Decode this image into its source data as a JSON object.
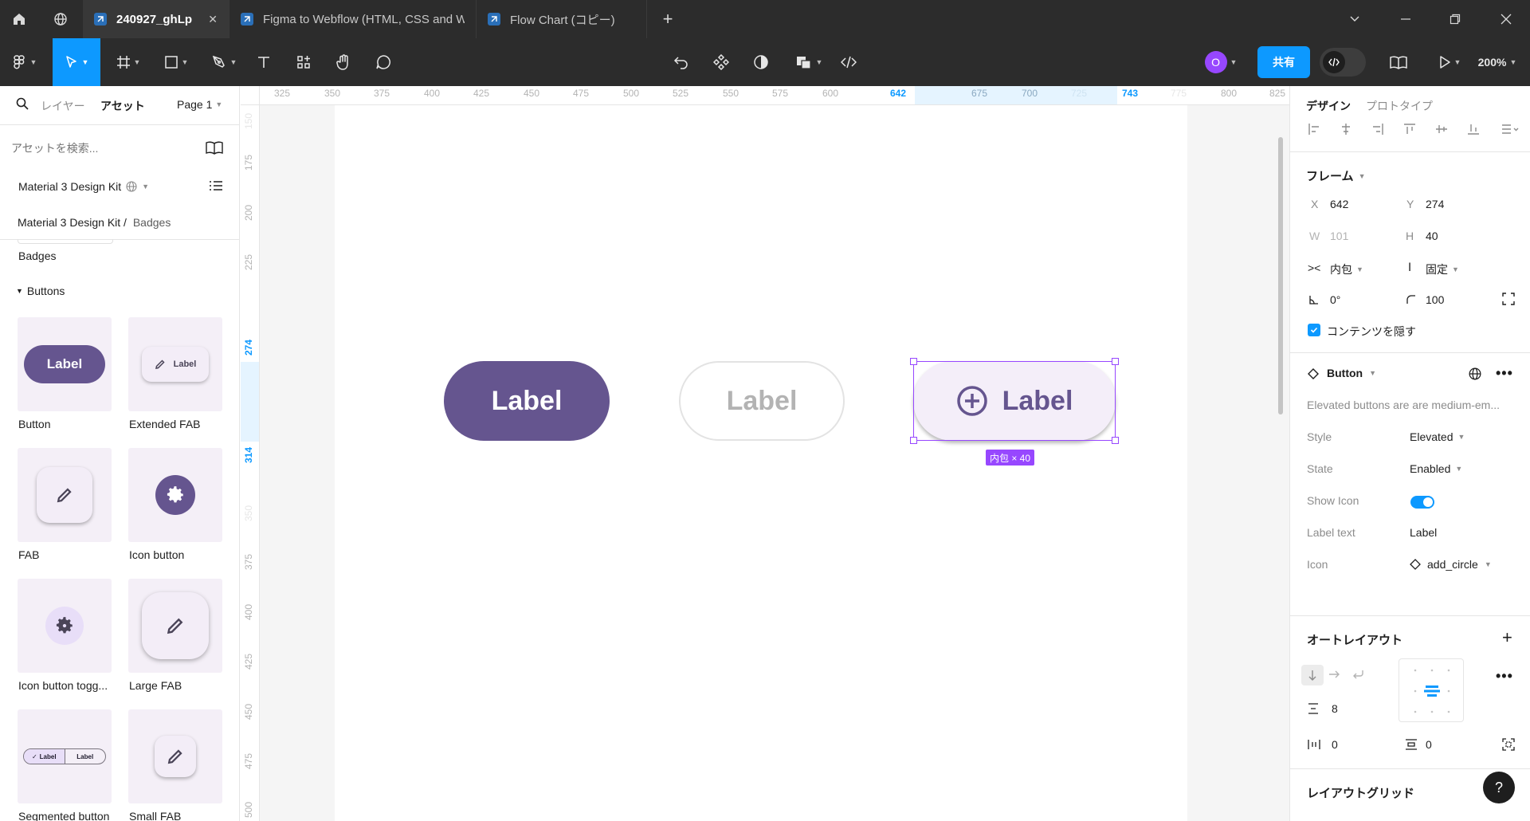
{
  "titlebar": {
    "tabs": [
      {
        "label": "240927_ghLp",
        "active": true
      },
      {
        "label": "Figma to Webflow (HTML, CSS and W",
        "active": false
      },
      {
        "label": "Flow Chart (コピー)",
        "active": false
      }
    ],
    "new_tab": "+"
  },
  "toolbar": {
    "share_label": "共有",
    "zoom": "200%",
    "avatar_initial": "O",
    "colors": {
      "accent": "#0d99ff",
      "avatar": "#9747ff",
      "bg": "#2c2c2c"
    }
  },
  "left_panel": {
    "tabs": [
      "レイヤー",
      "アセット"
    ],
    "active_tab": "アセット",
    "page": "Page 1",
    "search_placeholder": "アセットを検索...",
    "library_name": "Material 3 Design Kit",
    "breadcrumb_root": "Material 3 Design Kit /",
    "breadcrumb_current": "Badges",
    "prev_section": "Badges",
    "section": "Buttons",
    "assets": [
      {
        "name": "Button",
        "preview_text": "Label",
        "icon": "button-preview"
      },
      {
        "name": "Extended FAB",
        "preview_text": "Label",
        "icon": "pencil-icon"
      },
      {
        "name": "FAB",
        "preview_text": "",
        "icon": "pencil-icon"
      },
      {
        "name": "Icon button",
        "preview_text": "",
        "icon": "gear-icon"
      },
      {
        "name": "Icon button togg...",
        "preview_text": "",
        "icon": "gear-icon"
      },
      {
        "name": "Large FAB",
        "preview_text": "",
        "icon": "pencil-icon"
      },
      {
        "name": "Segmented button",
        "preview_text": "Label",
        "preview_text_2": "Label",
        "icon": "check-icon"
      },
      {
        "name": "Small FAB",
        "preview_text": "",
        "icon": "pencil-icon"
      }
    ]
  },
  "ruler": {
    "top": [
      "325",
      "350",
      "375",
      "400",
      "425",
      "450",
      "475",
      "500",
      "525",
      "550",
      "575",
      "600",
      "642",
      "675",
      "700",
      "725",
      "743",
      "775",
      "800",
      "825"
    ],
    "top_highlight": [
      "642",
      "743"
    ],
    "left": [
      "150",
      "175",
      "200",
      "225",
      "274",
      "314",
      "350",
      "375",
      "400",
      "425",
      "450",
      "475",
      "500"
    ],
    "left_highlight": [
      "274",
      "314"
    ]
  },
  "canvas": {
    "buttons": [
      {
        "label": "Label",
        "variant": "filled",
        "color": "#65558f"
      },
      {
        "label": "Label",
        "variant": "outlined-disabled",
        "color": "#b3b3b3"
      },
      {
        "label": "Label",
        "variant": "elevated",
        "color": "#65558f",
        "icon": "add-circle-icon"
      }
    ],
    "selection_badge": "内包 × 40",
    "selection_color": "#9747ff"
  },
  "right_panel": {
    "tabs": [
      "デザイン",
      "プロトタイプ"
    ],
    "active_tab": "デザイン",
    "frame_title": "フレーム",
    "x_label": "X",
    "x": "642",
    "y_label": "Y",
    "y": "274",
    "w_label": "W",
    "w": "101",
    "h_label": "H",
    "h": "40",
    "hug_label": "内包",
    "fixed_label": "固定",
    "rotation": "0°",
    "radius": "100",
    "clip_label": "コンテンツを隠す",
    "clip_checked": true,
    "component_name": "Button",
    "component_desc": "Elevated buttons are are medium-em...",
    "props": [
      {
        "label": "Style",
        "value": "Elevated",
        "dropdown": true
      },
      {
        "label": "State",
        "value": "Enabled",
        "dropdown": true
      },
      {
        "label": "Show Icon",
        "value": "",
        "toggle": true
      },
      {
        "label": "Label text",
        "value": "Label"
      },
      {
        "label": "Icon",
        "value": "add_circle",
        "dropdown": true
      }
    ],
    "autolayout_title": "オートレイアウト",
    "gap": "8",
    "padding_h": "0",
    "padding_v": "0",
    "layout_grid_title": "レイアウトグリッド",
    "help": "?"
  }
}
